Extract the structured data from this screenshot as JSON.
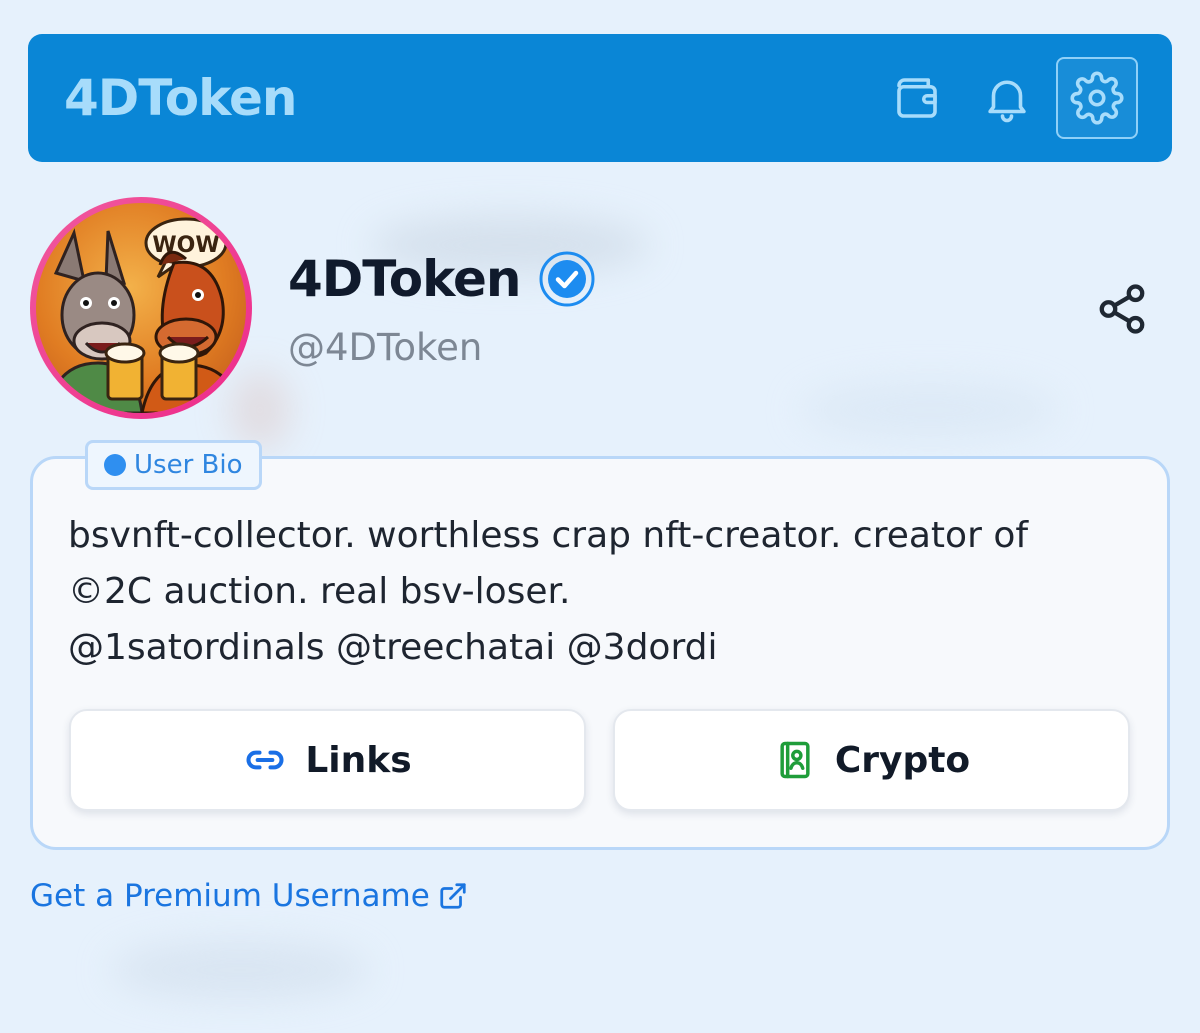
{
  "header": {
    "brand": "4DToken",
    "icons": [
      "wallet-icon",
      "bell-icon",
      "settings-icon"
    ],
    "background": "#0a86d6"
  },
  "profile": {
    "display_name": "4DToken",
    "handle": "@4DToken",
    "verified": true,
    "avatar_caption": "WOW"
  },
  "bio": {
    "label": "User Bio",
    "lines": [
      "bsvnft-collector. worthless crap nft-creator. creator of",
      "©2C auction. real bsv-loser.",
      "@1satordinals @treechatai @3dordi"
    ]
  },
  "buttons": {
    "links": "Links",
    "crypto": "Crypto"
  },
  "premium_link": "Get a Premium Username",
  "colors": {
    "accent": "#1a75e0",
    "verified": "#1d8cf0",
    "crypto_icon": "#1f9d3a",
    "avatar_ring": "#ee2a8a"
  }
}
